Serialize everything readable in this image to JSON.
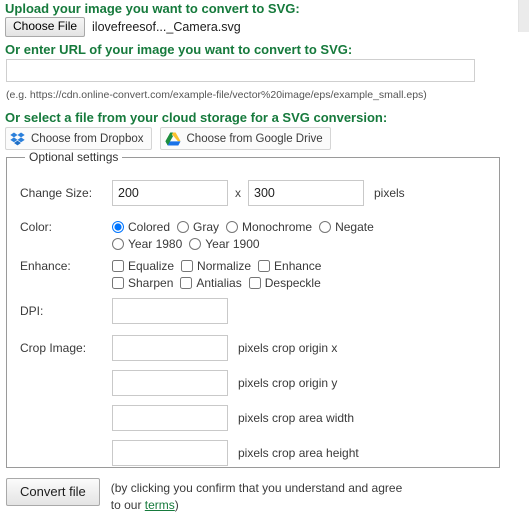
{
  "upload": {
    "heading": "Upload your image you want to convert to SVG:",
    "choose_file_label": "Choose File",
    "file_name": "ilovefreesof..._Camera.svg"
  },
  "url": {
    "heading": "Or enter URL of your image you want to convert to SVG:",
    "value": "",
    "placeholder": "",
    "hint": "(e.g. https://cdn.online-convert.com/example-file/vector%20image/eps/example_small.eps)"
  },
  "cloud": {
    "heading": "Or select a file from your cloud storage for a SVG conversion:",
    "dropbox_label": "Choose from Dropbox",
    "google_drive_label": "Choose from Google Drive",
    "dropbox_icon": "dropbox-icon",
    "google_drive_icon": "google-drive-icon"
  },
  "optional": {
    "legend": "Optional settings",
    "change_size": {
      "label": "Change Size:",
      "width_value": "200",
      "height_value": "300",
      "separator": "x",
      "unit": "pixels"
    },
    "color": {
      "label": "Color:",
      "selected": "Colored",
      "options": [
        {
          "label": "Colored",
          "checked": true
        },
        {
          "label": "Gray",
          "checked": false
        },
        {
          "label": "Monochrome",
          "checked": false
        },
        {
          "label": "Negate",
          "checked": false
        },
        {
          "label": "Year 1980",
          "checked": false
        },
        {
          "label": "Year 1900",
          "checked": false
        }
      ]
    },
    "enhance": {
      "label": "Enhance:",
      "options": [
        {
          "label": "Equalize",
          "checked": false
        },
        {
          "label": "Normalize",
          "checked": false
        },
        {
          "label": "Enhance",
          "checked": false
        },
        {
          "label": "Sharpen",
          "checked": false
        },
        {
          "label": "Antialias",
          "checked": false
        },
        {
          "label": "Despeckle",
          "checked": false
        }
      ]
    },
    "dpi": {
      "label": "DPI:",
      "value": ""
    },
    "crop": {
      "label": "Crop Image:",
      "fields": [
        {
          "value": "",
          "unit": "pixels crop origin x"
        },
        {
          "value": "",
          "unit": "pixels crop origin y"
        },
        {
          "value": "",
          "unit": "pixels crop area width"
        },
        {
          "value": "",
          "unit": "pixels crop area height"
        }
      ]
    }
  },
  "footer": {
    "convert_label": "Convert file",
    "terms_prefix": "(by clicking you confirm that you understand and agree to our ",
    "terms_link": "terms",
    "terms_suffix": ")"
  },
  "colors": {
    "heading_green": "#167a3c",
    "link_green": "#167a3c",
    "fieldset_border": "#9a9a9a",
    "input_border": "#c9c9c9"
  }
}
